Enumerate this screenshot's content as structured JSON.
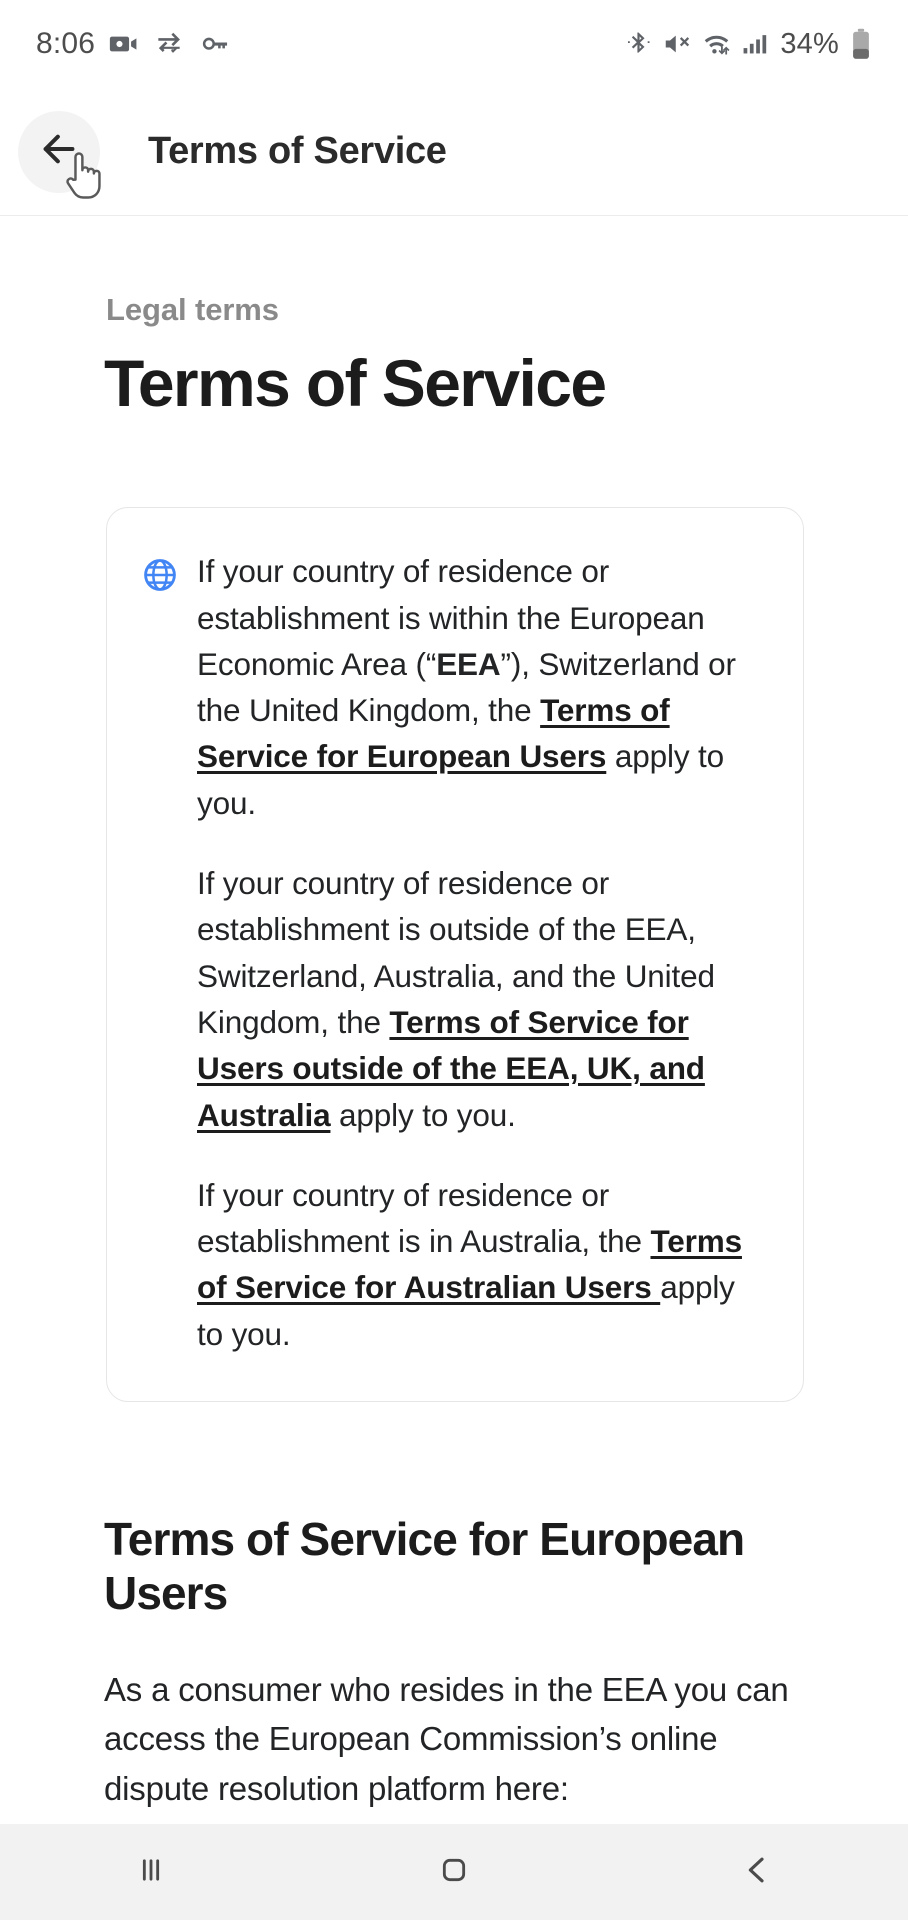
{
  "statusbar": {
    "time": "8:06",
    "battery_percent": "34%",
    "icons": [
      "video-camera-icon",
      "data-transfer-icon",
      "key-icon",
      "bluetooth-icon",
      "mute-icon",
      "wifi-icon",
      "cellular-signal-icon",
      "battery-icon"
    ]
  },
  "appbar": {
    "title": "Terms of Service",
    "back_icon": "back-arrow-icon",
    "cursor": "hand-pointer-cursor"
  },
  "page": {
    "eyebrow": "Legal terms",
    "title": "Terms of Service"
  },
  "card": {
    "icon": "globe-icon",
    "icon_color": "#4285f4",
    "paragraphs": [
      {
        "id": "p1",
        "parts": [
          {
            "type": "text",
            "text": "If your country of residence or establishment is within the European Economic Area (“"
          },
          {
            "type": "bold",
            "text": "EEA"
          },
          {
            "type": "text",
            "text": "”), Switzerland or the United Kingdom, the "
          },
          {
            "type": "link",
            "text": "Terms of Service for European Users"
          },
          {
            "type": "text",
            "text": " apply to you."
          }
        ]
      },
      {
        "id": "p2",
        "parts": [
          {
            "type": "text",
            "text": "If your country of residence or establishment is outside of the EEA, Switzerland, Australia, and the United Kingdom, the "
          },
          {
            "type": "link",
            "text": "Terms of Service for Users outside of the EEA, UK, and Australia"
          },
          {
            "type": "text",
            "text": " apply to you."
          }
        ]
      },
      {
        "id": "p3",
        "parts": [
          {
            "type": "text",
            "text": "If your country of residence or establishment is in Australia, the "
          },
          {
            "type": "link",
            "text": "Terms of Service for Australian Users "
          },
          {
            "type": "text",
            "text": "apply to you."
          }
        ]
      }
    ]
  },
  "section": {
    "heading": "Terms of Service for European Users",
    "body": "As a consumer who resides in the EEA you can access the European Commission’s online dispute resolution platform here:"
  },
  "navbar": {
    "items": [
      {
        "name": "recents-button",
        "icon": "recents-icon"
      },
      {
        "name": "home-button",
        "icon": "home-icon"
      },
      {
        "name": "back-button",
        "icon": "back-chevron-icon"
      }
    ]
  }
}
